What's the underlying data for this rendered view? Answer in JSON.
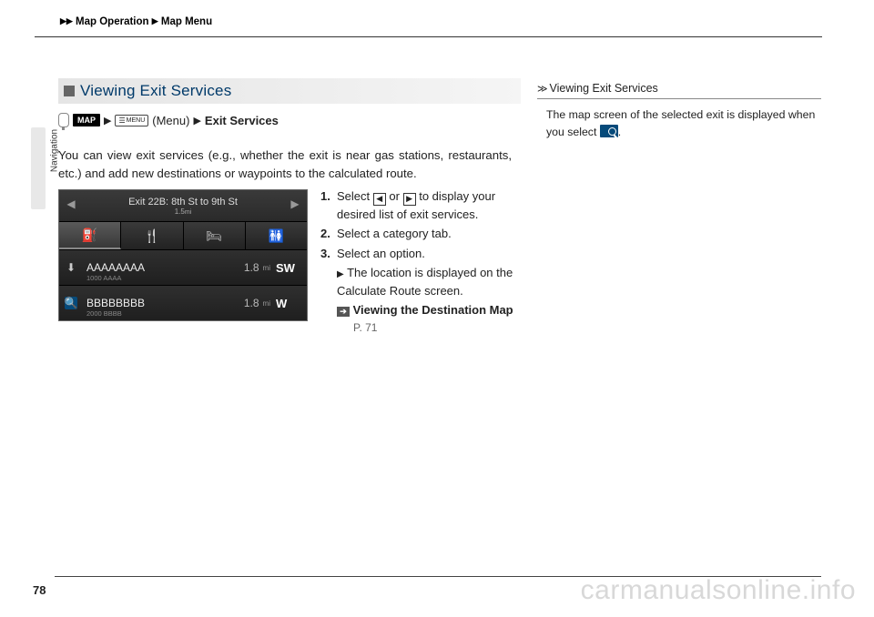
{
  "breadcrumb": {
    "a": "Map Operation",
    "b": "Map Menu"
  },
  "side_label": "Navigation",
  "heading": "Viewing Exit Services",
  "path": {
    "map": "MAP",
    "menu": "MENU",
    "menu_paren": "(Menu)",
    "dest": "Exit Services"
  },
  "body": "You can view exit services (e.g., whether the exit is near gas stations, restaurants, etc.) and add new destinations or waypoints to the calculated route.",
  "screenshot": {
    "title": "Exit 22B: 8th St to 9th St",
    "sub": "1.5",
    "rows": [
      {
        "name": "AAAAAAAA",
        "sub": "1000 AAAA",
        "dist": "1.8",
        "dir": "SW"
      },
      {
        "name": "BBBBBBBB",
        "sub": "2000 BBBB",
        "dist": "1.8",
        "dir": "W"
      }
    ]
  },
  "steps": {
    "s1a": "Select",
    "s1b": "or",
    "s1c": "to display your desired list of exit services.",
    "s2": "Select a category tab.",
    "s3": "Select an option.",
    "s3sub": "The location is displayed on the Calculate Route screen.",
    "xref": "Viewing the Destination Map",
    "xref_page": "P. 71"
  },
  "right": {
    "hd": "Viewing Exit Services",
    "note_a": "The map screen of the selected exit is displayed when you select",
    "note_b": "."
  },
  "page": "78",
  "watermark": "carmanualsonline.info"
}
